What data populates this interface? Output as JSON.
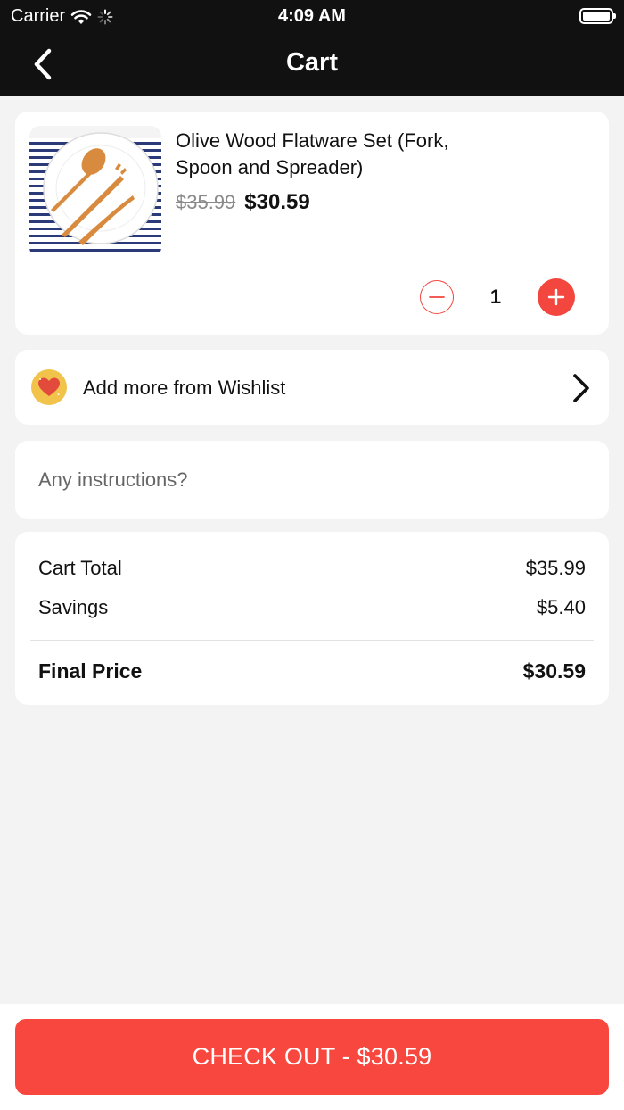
{
  "status_bar": {
    "carrier": "Carrier",
    "time": "4:09 AM",
    "icons": [
      "wifi-icon",
      "activity-spinner-icon",
      "battery-icon"
    ]
  },
  "nav": {
    "title": "Cart",
    "back_icon": "chevron-left-icon"
  },
  "cart_item": {
    "name": "Olive Wood Flatware Set (Fork, Spoon and Spreader)",
    "original_price": "$35.99",
    "price": "$30.59",
    "quantity": "1",
    "image_icon": "product-photo-flatware"
  },
  "wishlist": {
    "label": "Add more from Wishlist",
    "icon": "heart-icon"
  },
  "instructions": {
    "placeholder": "Any instructions?",
    "value": ""
  },
  "summary": {
    "rows": [
      {
        "label": "Cart Total",
        "value": "$35.99"
      },
      {
        "label": "Savings",
        "value": "$5.40"
      }
    ],
    "final_label": "Final Price",
    "final_value": "$30.59"
  },
  "checkout": {
    "label": "CHECK OUT - $30.59"
  },
  "colors": {
    "accent": "#f7473f",
    "header_bg": "#111111",
    "page_bg": "#f3f3f3",
    "wishlist_badge": "#f1c34a"
  }
}
